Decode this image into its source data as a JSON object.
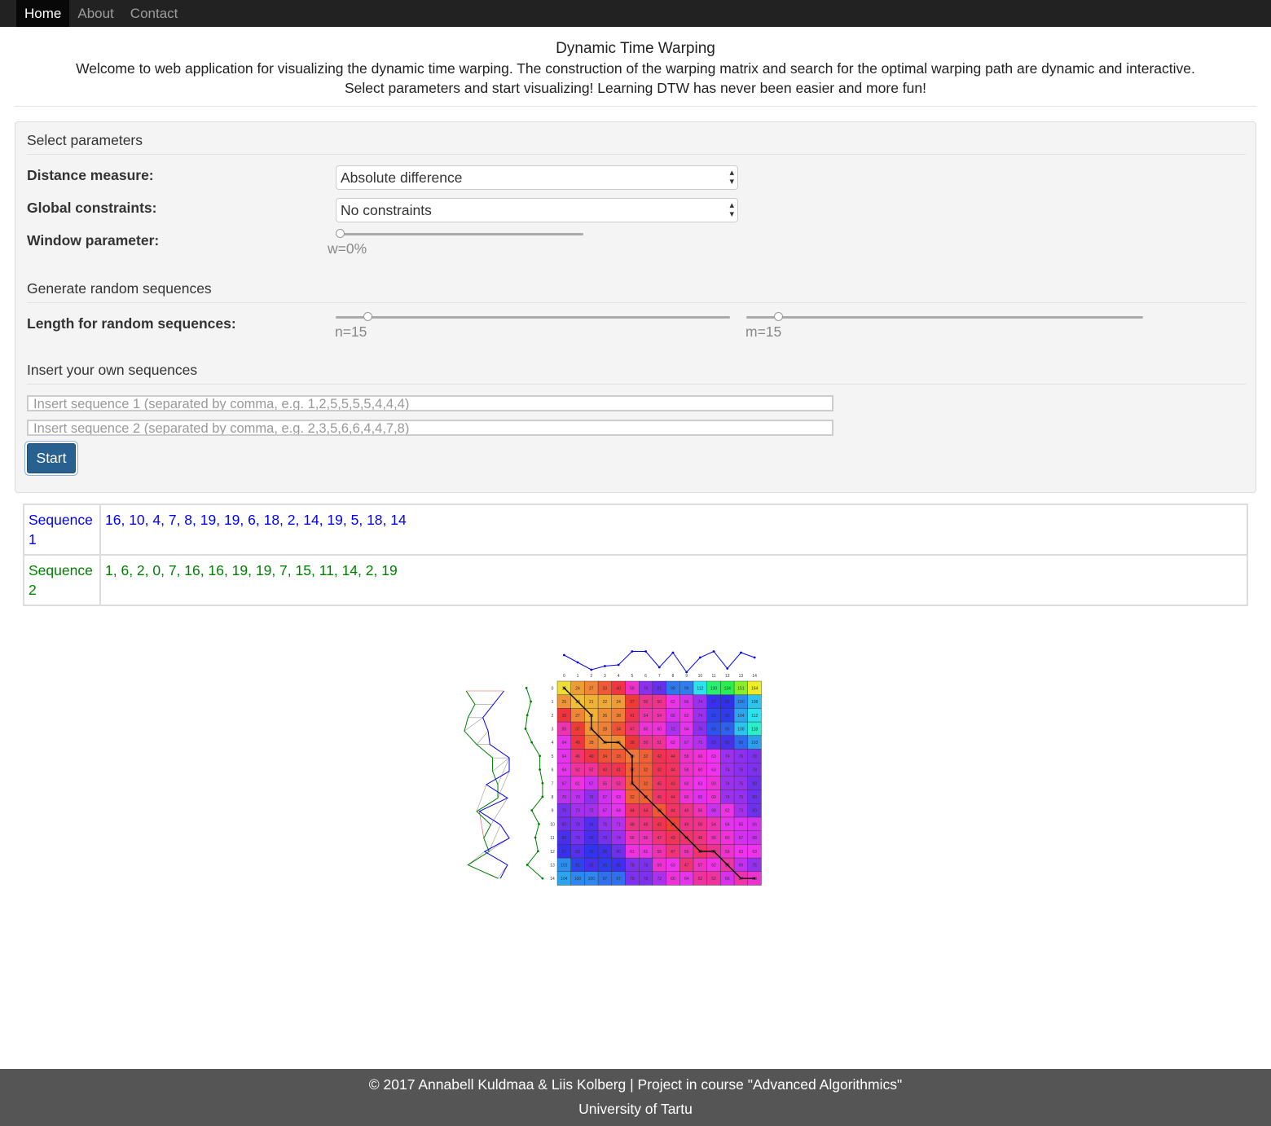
{
  "nav": {
    "items": [
      {
        "label": "Home",
        "active": true
      },
      {
        "label": "About",
        "active": false
      },
      {
        "label": "Contact",
        "active": false
      }
    ]
  },
  "header": {
    "title": "Dynamic Time Warping",
    "intro_line1": "Welcome to web application for visualizing the dynamic time warping. The construction of the warping matrix and search for the optimal warping path are dynamic and interactive.",
    "intro_line2": "Select parameters and start visualizing! Learning DTW has never been easier and more fun!"
  },
  "params": {
    "section_title": "Select parameters",
    "distance_label": "Distance measure:",
    "distance_value": "Absolute difference",
    "constraints_label": "Global constraints:",
    "constraints_value": "No constraints",
    "window_label": "Window parameter:",
    "window_value": "w=0%",
    "window_level": 0
  },
  "random": {
    "section_title": "Generate random sequences",
    "length_label": "Length for random sequences:",
    "n_value": "n=15",
    "m_value": "m=15"
  },
  "own": {
    "section_title": "Insert your own sequences",
    "seq1_placeholder": "Insert sequence 1 (separated by comma, e.g. 1,2,5,5,5,5,4,4,4)",
    "seq2_placeholder": "Insert sequence 2 (separated by comma, e.g. 2,3,5,6,6,4,4,7,8)"
  },
  "start_label": "Start",
  "sequences": {
    "seq1_label": "Sequence 1",
    "seq1_values": "16, 10, 4, 7, 8, 19, 19, 6, 18, 2, 14, 19, 5, 18, 14",
    "seq2_label": "Sequence 2",
    "seq2_values": "1, 6, 2, 0, 7, 16, 16, 19, 19, 7, 15, 11, 14, 2, 19"
  },
  "colors": {
    "seq1": "#0000ff",
    "seq2": "#008000",
    "path": "#000000",
    "mismatch_link": "#e05050",
    "match_link": "#999999"
  },
  "footer": {
    "line1": "© 2017 Annabell Kuldmaa & Liis Kolberg | Project in course \"Advanced Algorithmics\"",
    "line2": "University of Tartu"
  }
}
